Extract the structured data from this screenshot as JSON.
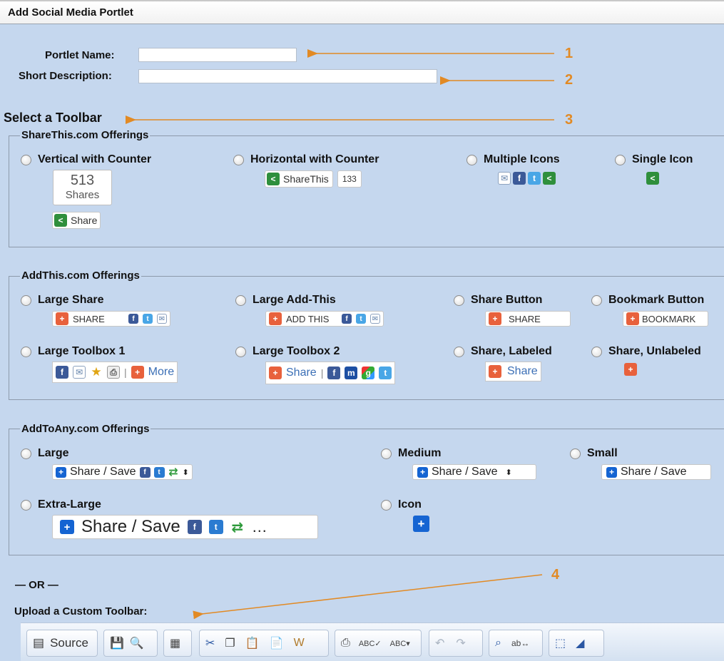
{
  "window": {
    "title": "Add Social Media Portlet"
  },
  "form": {
    "portlet_name_label": "Portlet Name:",
    "portlet_name_value": "",
    "short_description_label": "Short Description:",
    "short_description_value": ""
  },
  "select_toolbar_heading": "Select a Toolbar",
  "callouts": [
    "1",
    "2",
    "3",
    "4"
  ],
  "sharethis": {
    "legend": "ShareThis.com Offerings",
    "options": [
      {
        "label": "Vertical with Counter",
        "count": "513",
        "count_unit": "Shares",
        "button": "Share"
      },
      {
        "label": "Horizontal with Counter",
        "button": "ShareThis",
        "count": "133"
      },
      {
        "label": "Multiple Icons"
      },
      {
        "label": "Single Icon"
      }
    ]
  },
  "addthis": {
    "legend": "AddThis.com Offerings",
    "options": [
      {
        "label": "Large Share",
        "button": "SHARE"
      },
      {
        "label": "Large Add-This",
        "button": "ADD THIS"
      },
      {
        "label": "Share Button",
        "button": "SHARE"
      },
      {
        "label": "Bookmark Button",
        "button": "BOOKMARK"
      },
      {
        "label": "Large Toolbox 1",
        "button": "More"
      },
      {
        "label": "Large Toolbox 2",
        "button": "Share"
      },
      {
        "label": "Share, Labeled",
        "button": "Share"
      },
      {
        "label": "Share, Unlabeled"
      }
    ]
  },
  "addtoany": {
    "legend": "AddToAny.com Offerings",
    "options": [
      {
        "label": "Large",
        "button": "Share / Save"
      },
      {
        "label": "Medium",
        "button": "Share / Save"
      },
      {
        "label": "Small",
        "button": "Share / Save"
      },
      {
        "label": "Extra-Large",
        "button": "Share / Save"
      },
      {
        "label": "Icon"
      }
    ]
  },
  "or_divider": "— OR —",
  "upload_label": "Upload a Custom Toolbar:",
  "editor_toolbar": {
    "source_label": "Source",
    "icons": [
      "source-icon",
      "save-icon",
      "preview-icon",
      "templates-icon",
      "cut-icon",
      "copy-icon",
      "paste-icon",
      "paste-text-icon",
      "paste-word-icon",
      "print-icon",
      "spellcheck-icon",
      "spellcheck-dropdown-icon",
      "undo-icon",
      "redo-icon",
      "find-icon",
      "replace-icon",
      "select-all-icon",
      "remove-format-icon"
    ]
  },
  "colors": {
    "background": "#c5d7ee",
    "callout": "#e28a24",
    "sharethis_green": "#2f8f3c",
    "addthis_orange": "#e8613c",
    "addtoany_blue": "#1564d2"
  }
}
